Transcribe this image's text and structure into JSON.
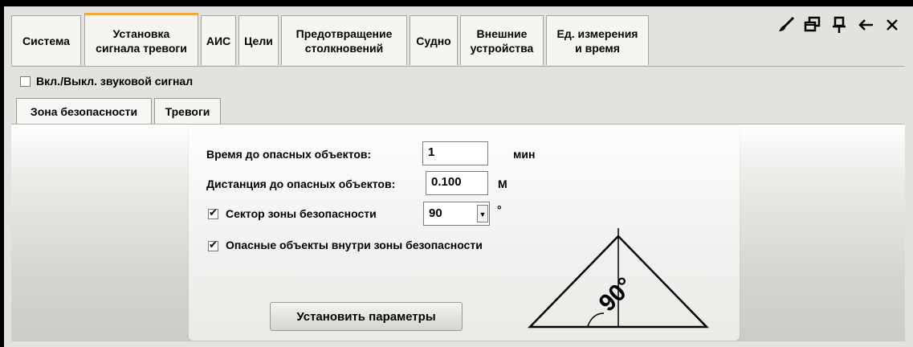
{
  "tabs": [
    {
      "label": "Система"
    },
    {
      "label": "Установка\nсигнала тревоги"
    },
    {
      "label": "АИС"
    },
    {
      "label": "Цели"
    },
    {
      "label": "Предотвращение\nстолкновений"
    },
    {
      "label": "Судно"
    },
    {
      "label": "Внешние\nустройства"
    },
    {
      "label": "Ед. измерения\nи время"
    }
  ],
  "toolbar": {
    "icons": [
      "brush-icon",
      "restore-window-icon",
      "pin-icon",
      "back-arrow-icon",
      "close-icon"
    ],
    "glyphs": [
      "🖌",
      "🗗",
      "📌",
      "←",
      "✕"
    ]
  },
  "sound_toggle": {
    "label": "Вкл./Выкл. звуковой сигнал",
    "checked": false
  },
  "subtabs": [
    {
      "label": "Зона безопасности"
    },
    {
      "label": "Тревоги"
    }
  ],
  "form": {
    "time_label": "Время до опасных объектов:",
    "time_value": "1",
    "time_unit": "мин",
    "distance_label": "Дистанция до опасных объектов:",
    "distance_value": "0.100",
    "distance_unit": "М",
    "sector_label": "Сектор зоны безопасности",
    "sector_checked": true,
    "sector_value": "90",
    "sector_unit": "°",
    "inside_label": "Опасные объекты внутри зоны безопасности",
    "inside_checked": true,
    "apply_button": "Установить параметры"
  },
  "diagram": {
    "angle_label": "90°"
  }
}
